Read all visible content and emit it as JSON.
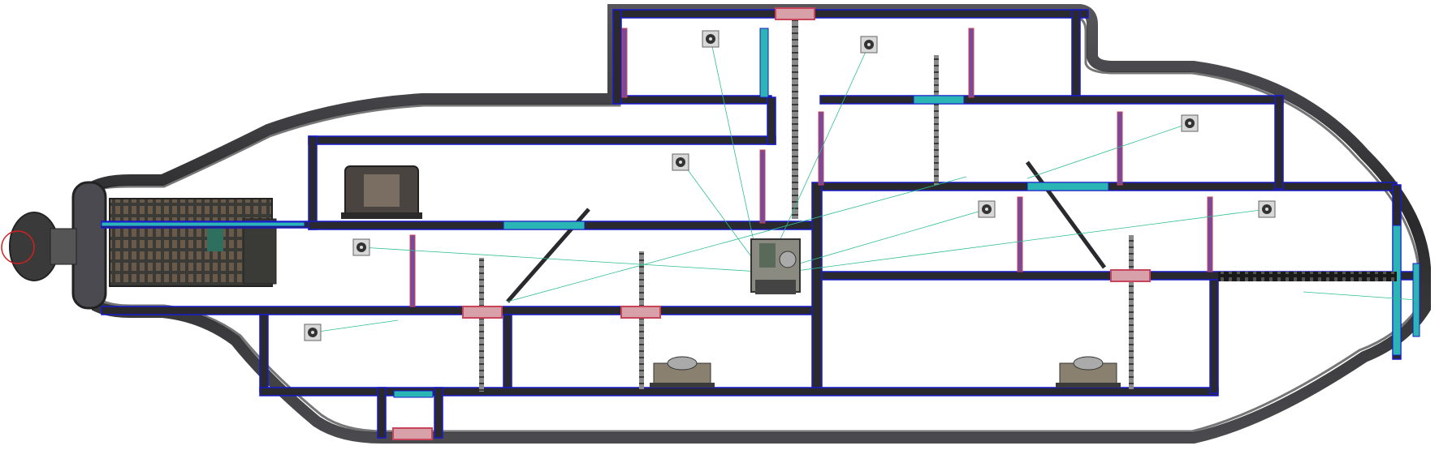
{
  "editor": {
    "view": "submarine-layout-editor",
    "colors": {
      "background": "#ffffff",
      "hull_dark": "#2c2c2e",
      "hull_mid": "#5a5a5e",
      "wall": "#2a2a2e",
      "wall_outline": "#1a1acc",
      "hatch": "#c8445a",
      "door_frame": "#7a4a9a",
      "ladder": "#6e6e6e",
      "vent_pipe": "#2bb5b5",
      "wire": "#2fbf8f",
      "waypoint_circle": "#d02020"
    }
  },
  "devices": {
    "reactor_label": "",
    "engine_label": "",
    "navigation_label": ""
  }
}
